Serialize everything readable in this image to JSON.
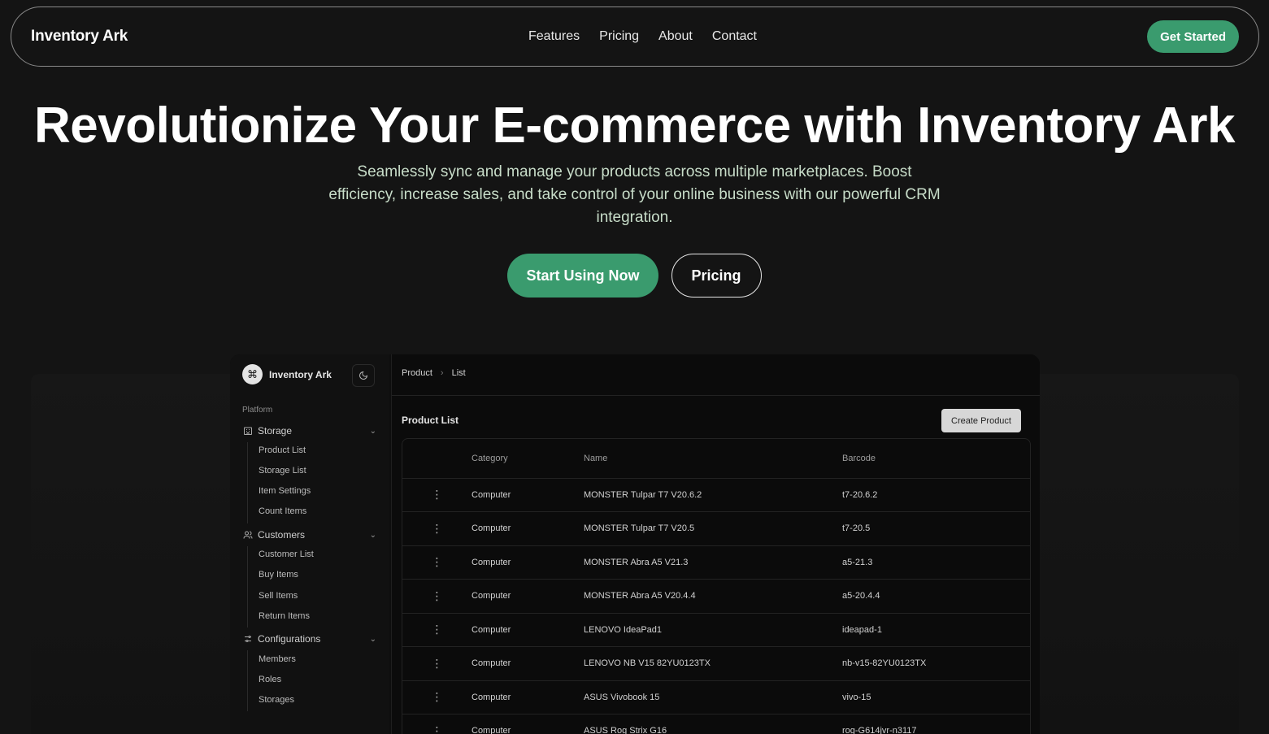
{
  "nav": {
    "brand": "Inventory Ark",
    "links": [
      "Features",
      "Pricing",
      "About",
      "Contact"
    ],
    "cta": "Get Started"
  },
  "hero": {
    "title": "Revolutionize Your E-commerce with Inventory Ark",
    "subtitle": "Seamlessly sync and manage your products across multiple marketplaces. Boost efficiency, increase sales, and take control of your online business with our powerful CRM integration.",
    "primary_cta": "Start Using Now",
    "secondary_cta": "Pricing"
  },
  "app": {
    "brand": "Inventory Ark",
    "section_label": "Platform",
    "groups": [
      {
        "label": "Storage",
        "icon": "building-icon",
        "items": [
          "Product List",
          "Storage List",
          "Item Settings",
          "Count Items"
        ]
      },
      {
        "label": "Customers",
        "icon": "users-icon",
        "items": [
          "Customer List",
          "Buy Items",
          "Sell Items",
          "Return Items"
        ]
      },
      {
        "label": "Configurations",
        "icon": "settings-icon",
        "items": [
          "Members",
          "Roles",
          "Storages"
        ]
      }
    ],
    "breadcrumb": [
      "Product",
      "List"
    ],
    "list_title": "Product List",
    "create_label": "Create Product",
    "columns": [
      "Category",
      "Name",
      "Barcode"
    ],
    "rows": [
      {
        "category": "Computer",
        "name": "MONSTER Tulpar T7 V20.6.2",
        "barcode": "t7-20.6.2"
      },
      {
        "category": "Computer",
        "name": "MONSTER Tulpar T7 V20.5",
        "barcode": "t7-20.5"
      },
      {
        "category": "Computer",
        "name": "MONSTER Abra A5 V21.3",
        "barcode": "a5-21.3"
      },
      {
        "category": "Computer",
        "name": "MONSTER Abra A5 V20.4.4",
        "barcode": "a5-20.4.4"
      },
      {
        "category": "Computer",
        "name": "LENOVO IdeaPad1",
        "barcode": "ideapad-1"
      },
      {
        "category": "Computer",
        "name": "LENOVO NB V15 82YU0123TX",
        "barcode": "nb-v15-82YU0123TX"
      },
      {
        "category": "Computer",
        "name": "ASUS Vivobook 15",
        "barcode": "vivo-15"
      },
      {
        "category": "Computer",
        "name": "ASUS Rog Strix G16",
        "barcode": "rog-G614jvr-n3117"
      }
    ]
  },
  "colors": {
    "accent": "#3a9b6e",
    "background": "#141414"
  }
}
